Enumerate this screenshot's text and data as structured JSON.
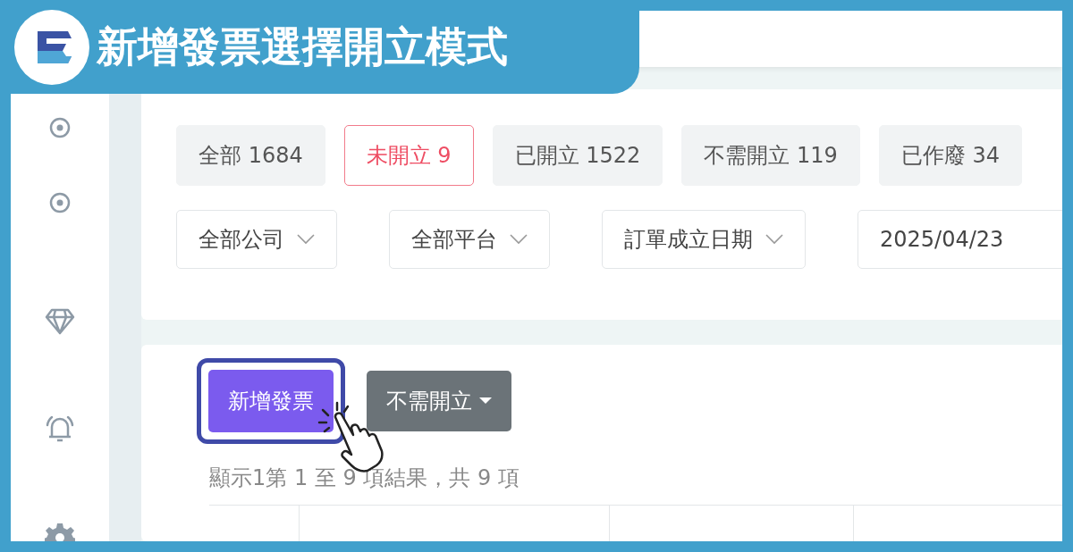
{
  "banner": {
    "title": "新增發票選擇開立模式"
  },
  "status_tabs": [
    {
      "label": "全部 1684",
      "selected": false
    },
    {
      "label": "未開立 9",
      "selected": true
    },
    {
      "label": "已開立 1522",
      "selected": false
    },
    {
      "label": "不需開立 119",
      "selected": false
    },
    {
      "label": "已作廢 34",
      "selected": false
    }
  ],
  "filters": [
    {
      "kind": "select",
      "label": "全部公司"
    },
    {
      "kind": "select",
      "label": "全部平台"
    },
    {
      "kind": "select",
      "label": "訂單成立日期"
    },
    {
      "kind": "date",
      "label": "2025/04/23"
    }
  ],
  "actions": {
    "primary": "新增發票",
    "dropdown": "不需開立",
    "highlighted": true
  },
  "result_summary": "顯示1第 1 至 9 項結果，共 9 項"
}
